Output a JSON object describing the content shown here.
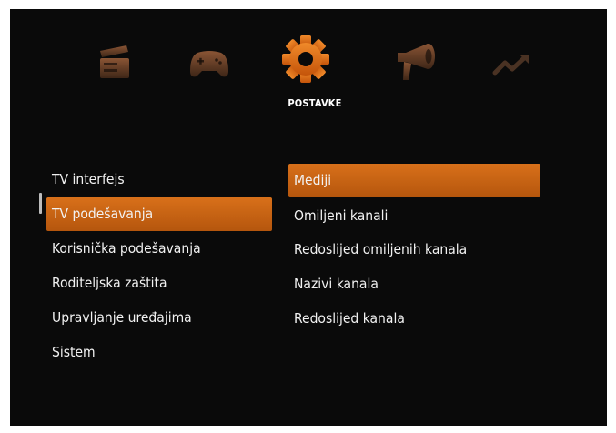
{
  "header": {
    "active_tab_label": "POSTAVKE",
    "icons": [
      {
        "name": "clapperboard-icon",
        "state": "dimmed"
      },
      {
        "name": "gamepad-icon",
        "state": "dimmed"
      },
      {
        "name": "gear-icon",
        "state": "active"
      },
      {
        "name": "megaphone-icon",
        "state": "dimmed"
      },
      {
        "name": "trending-arrow-icon",
        "state": "dimmed"
      }
    ]
  },
  "left_menu": {
    "items": [
      {
        "label": "TV interfejs"
      },
      {
        "label": "TV podešavanja",
        "selected": true
      },
      {
        "label": "Korisnička podešavanja"
      },
      {
        "label": "Roditeljska zaštita"
      },
      {
        "label": "Upravljanje uređajima"
      },
      {
        "label": "Sistem"
      }
    ]
  },
  "right_menu": {
    "items": [
      {
        "label": "Mediji",
        "selected": true
      },
      {
        "label": "Omiljeni kanali"
      },
      {
        "label": "Redoslijed omiljenih kanala"
      },
      {
        "label": "Nazivi kanala"
      },
      {
        "label": "Redoslijed kanala"
      }
    ]
  },
  "colors": {
    "background": "#0a0a0a",
    "accent": "#c9620f",
    "icon_dim": "#5a3a24",
    "text": "#f2f2f2"
  }
}
